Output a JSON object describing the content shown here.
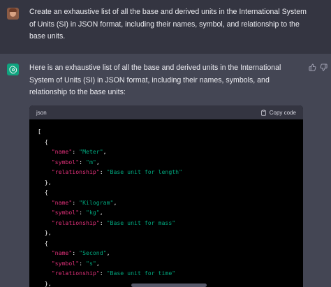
{
  "user_message": {
    "text": "Create an exhaustive list of all the base and derived units in the International System of Units (SI) in JSON format, including their names, symbol, and relationship to the base units."
  },
  "assistant_message": {
    "text": "Here is an exhaustive list of all the base and derived units in the International System of Units (SI) in JSON format, including their names, symbols, and relationship to the base units:"
  },
  "code_block": {
    "language": "json",
    "copy_label": "Copy code",
    "open_bracket": "[",
    "entries": [
      {
        "name": "Meter",
        "symbol": "m",
        "relationship": "Base unit for length"
      },
      {
        "name": "Kilogram",
        "symbol": "kg",
        "relationship": "Base unit for mass"
      },
      {
        "name": "Second",
        "symbol": "s",
        "relationship": "Base unit for time"
      }
    ]
  },
  "colors": {
    "user_bg": "#343541",
    "assistant_bg": "#444654",
    "code_bg": "#000000",
    "code_header_bg": "#343541",
    "json_key": "#df3079",
    "json_string": "#00a67d",
    "bot_avatar": "#10a37f"
  },
  "icons": [
    "user-avatar",
    "chatgpt-logo-icon",
    "thumbs-up-icon",
    "thumbs-down-icon",
    "clipboard-icon"
  ]
}
